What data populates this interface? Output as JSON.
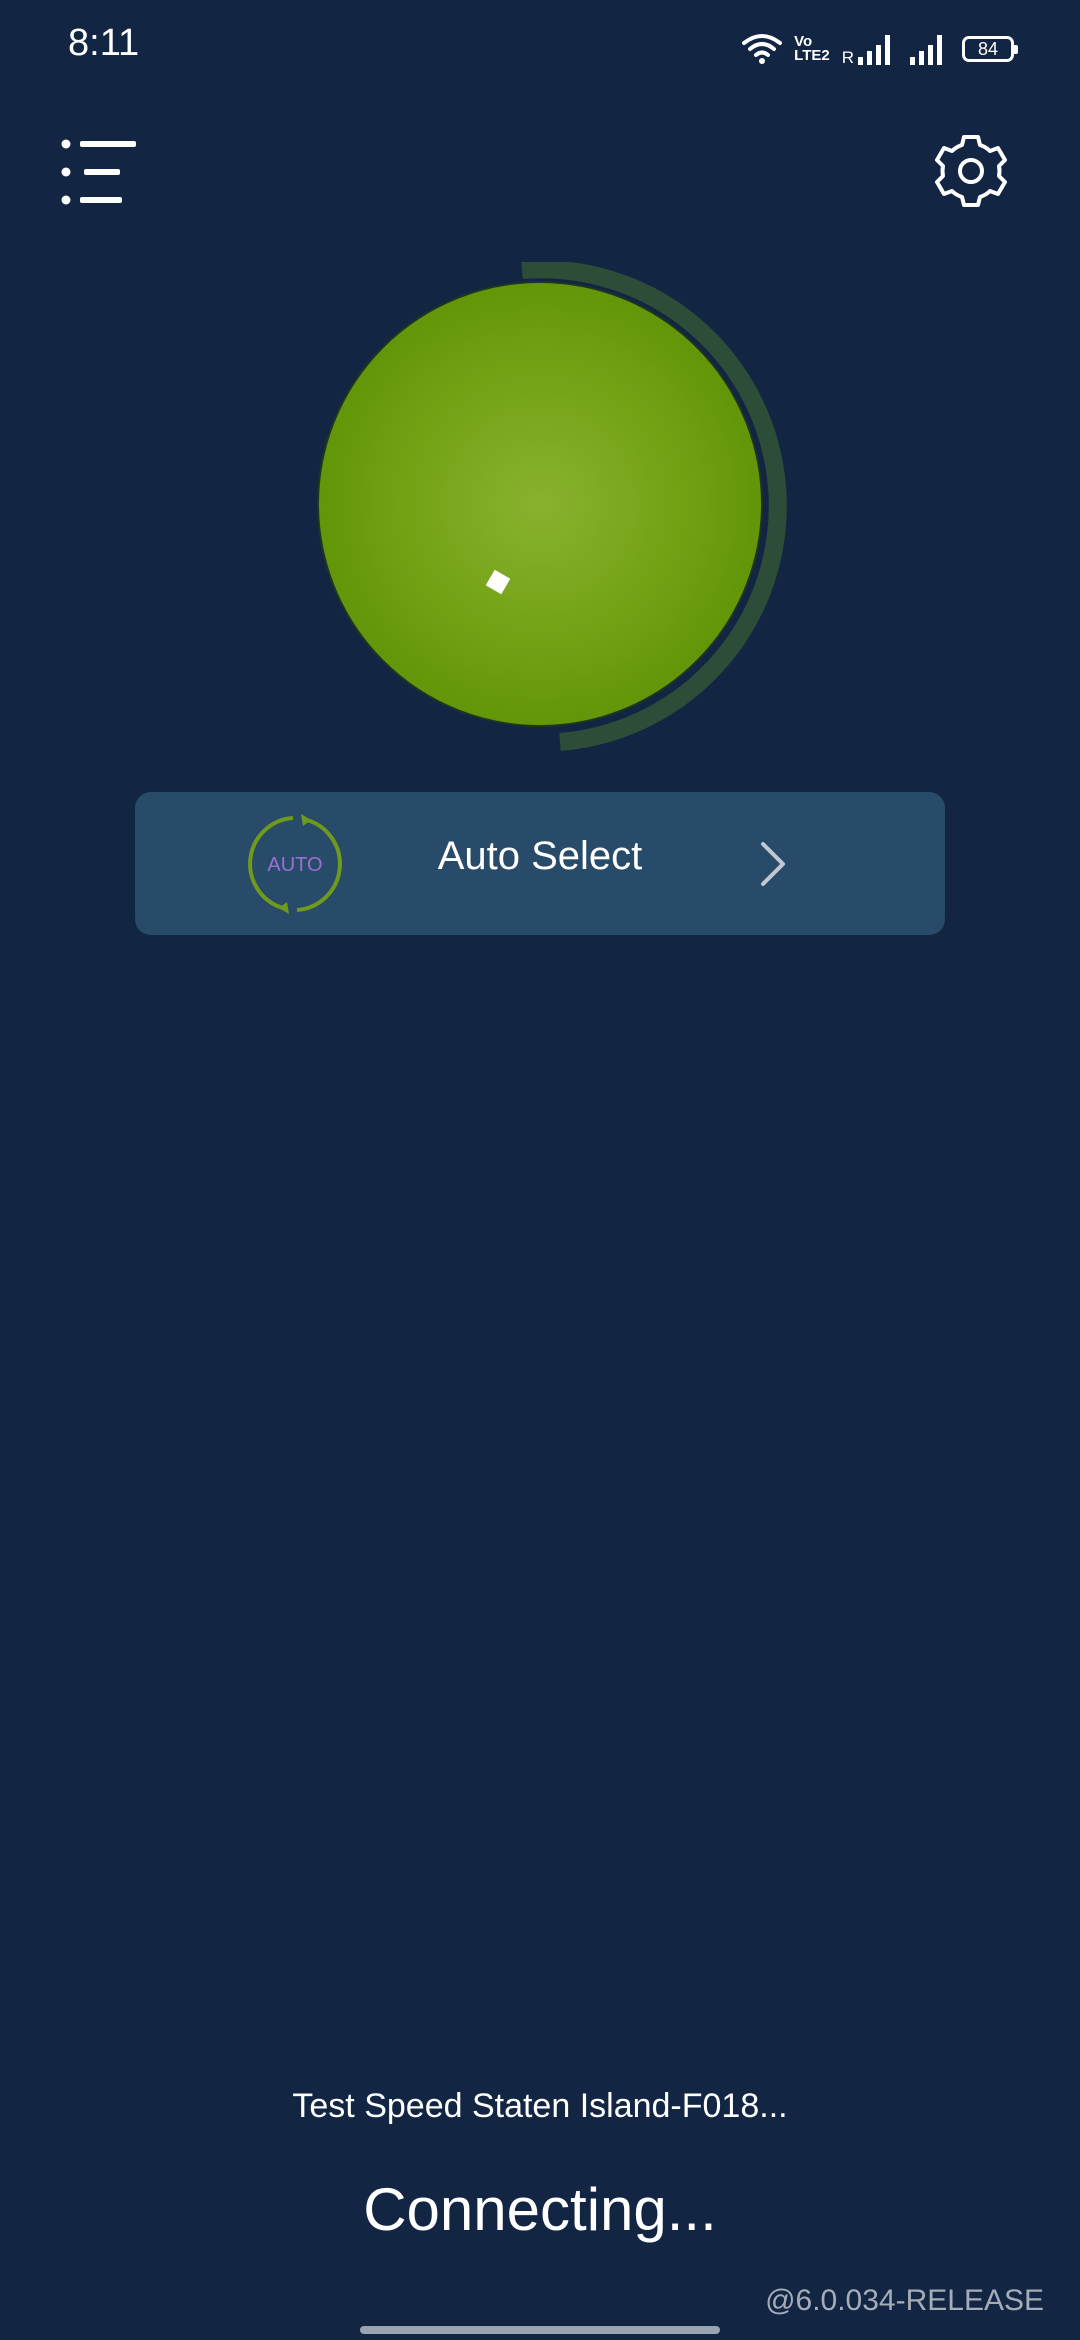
{
  "status_bar": {
    "time": "8:11",
    "volte_top": "Vo",
    "volte_bottom": "LTE2",
    "roaming": "R",
    "battery": "84",
    "icons": [
      "wifi-icon",
      "volte-icon",
      "signal-icon",
      "signal-icon",
      "battery-icon"
    ]
  },
  "toolbar": {
    "menu_icon": "menu-list-icon",
    "settings_icon": "gear-icon"
  },
  "connect_button": {
    "color": "#6a9a0b",
    "progress_ring_color": "#2f4f3a"
  },
  "server_selector": {
    "badge_text": "AUTO",
    "label": "Auto Select",
    "badge_color": "#6f9a1c",
    "badge_text_color": "#9b6fd4",
    "chevron_icon": "chevron-right-icon"
  },
  "connection": {
    "server_name": "Test Speed Staten Island-F018...",
    "status": "Connecting..."
  },
  "footer": {
    "version": "@6.0.034-RELEASE"
  },
  "colors": {
    "background": "#122644",
    "panel": "#284b69",
    "accent_green": "#6a9a0b"
  }
}
